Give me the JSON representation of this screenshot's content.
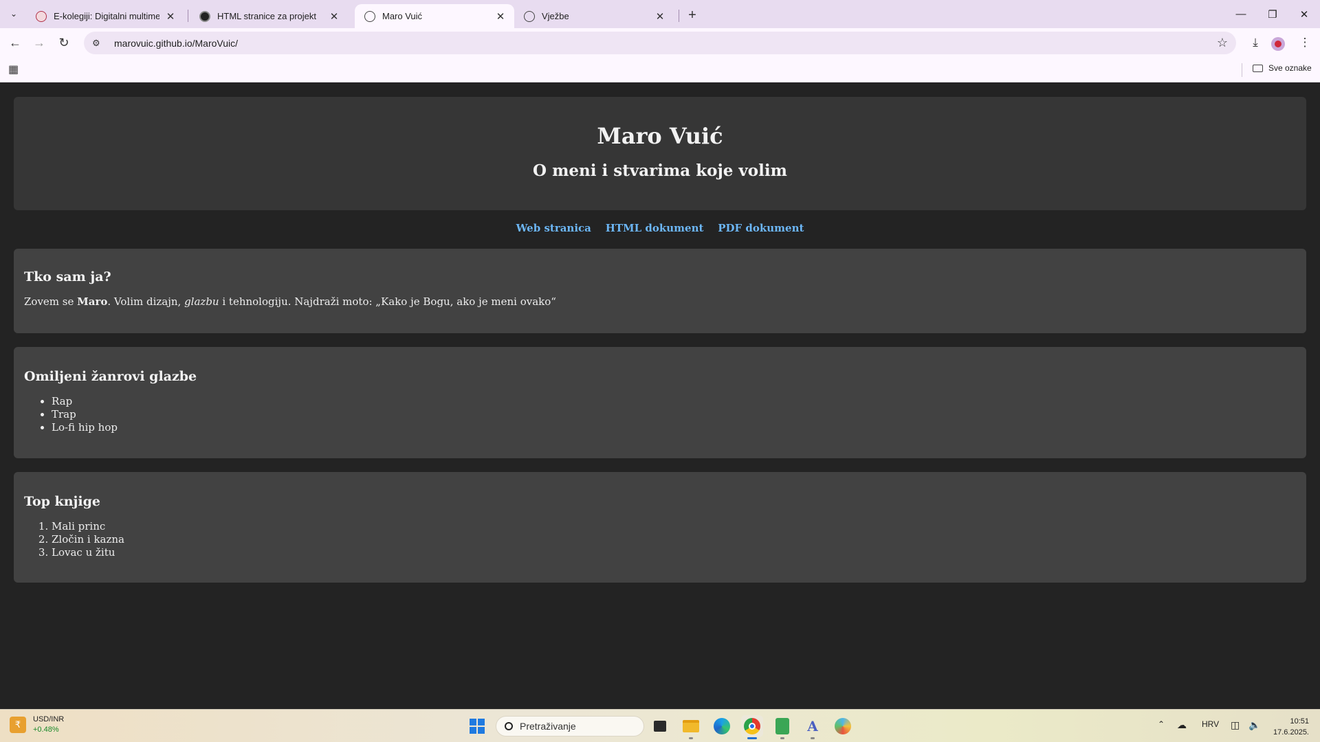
{
  "browser": {
    "tabs": [
      {
        "title": "E-kolegiji: Digitalni multimedij",
        "active": false
      },
      {
        "title": "HTML stranice za projekt",
        "active": false
      },
      {
        "title": "Maro Vuić",
        "active": true
      },
      {
        "title": "Vježbe",
        "active": false
      }
    ],
    "url": "marovuic.github.io/MaroVuic/",
    "bookmarks_all_label": "Sve oznake"
  },
  "page": {
    "title": "Maro Vuić",
    "subtitle": "O meni i stvarima koje volim",
    "nav": [
      "Web stranica",
      "HTML dokument",
      "PDF dokument"
    ],
    "about": {
      "heading": "Tko sam ja?",
      "text_before": "Zovem se ",
      "name": "Maro",
      "text_mid": ". Volim dizajn, ",
      "emph": "glazbu",
      "text_after": " i tehnologiju. Najdraži moto: „Kako je Bogu, ako je meni ovako“"
    },
    "genres": {
      "heading": "Omiljeni žanrovi glazbe",
      "items": [
        "Rap",
        "Trap",
        "Lo-fi hip hop"
      ]
    },
    "books": {
      "heading": "Top knjige",
      "items": [
        "Mali princ",
        "Zločin i kazna",
        "Lovac u žitu"
      ]
    }
  },
  "taskbar": {
    "widget_title": "USD/INR",
    "widget_change": "+0.48%",
    "search_placeholder": "Pretraživanje",
    "language": "HRV",
    "time": "10:51",
    "date": "17.6.2025."
  },
  "colors": {
    "page_bg": "#232323",
    "header_bg": "#363636",
    "card_bg": "#424242",
    "link": "#6cb6f5",
    "tabstrip": "#e8dcf0",
    "toolbar": "#fdf7ff"
  }
}
